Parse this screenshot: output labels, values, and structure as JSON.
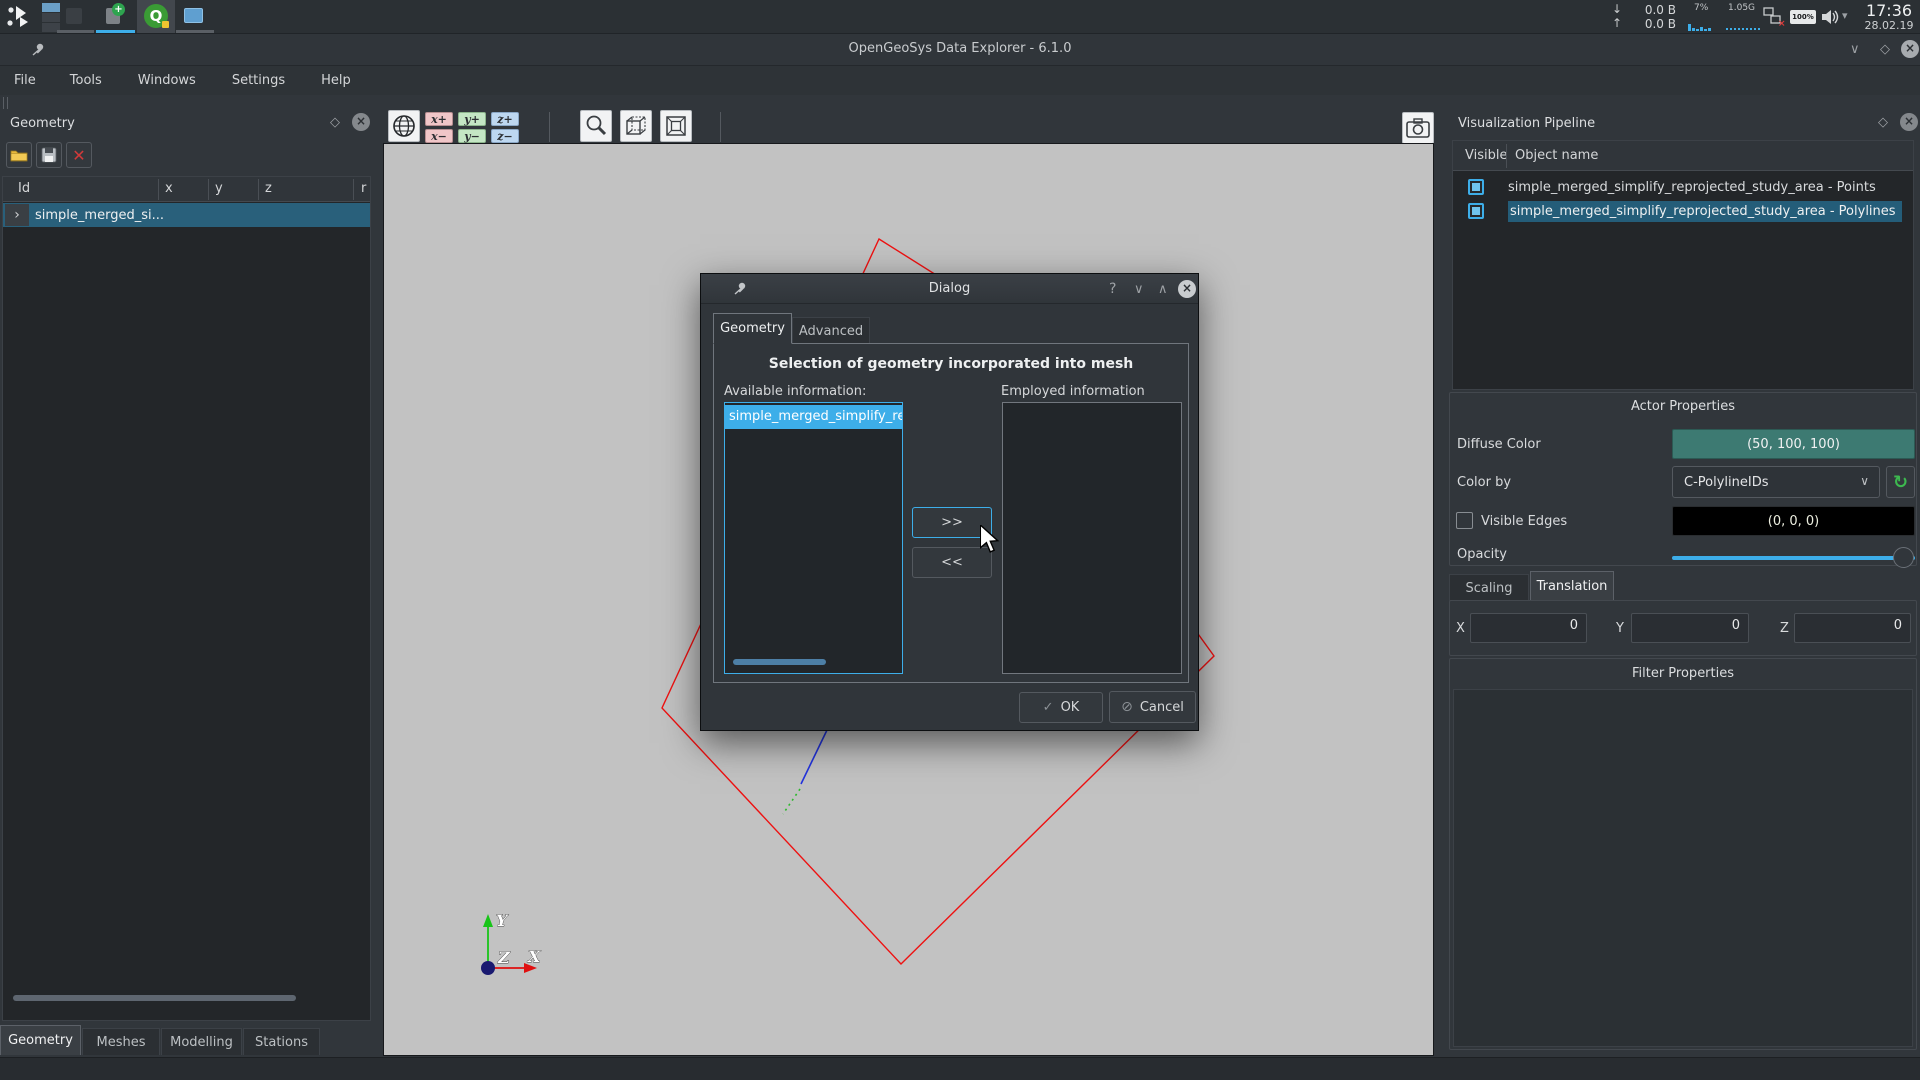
{
  "colors": {
    "accent": "#3daee9",
    "diffuse_button": "#3d7a72",
    "edges_button": "#000000",
    "viewport_bg": "#c2c2c2",
    "selection_row": "#29607b",
    "line_red": "#ee1111",
    "line_blue": "#2233dd",
    "line_green": "#2db92d"
  },
  "taskbar": {
    "tray": {
      "down_label": "0.0 B",
      "up_label": "0.0 B",
      "cpu": "7%",
      "mem": "1.05G",
      "battery": "100%"
    },
    "clock": {
      "time": "17:36",
      "date": "28.02.19"
    }
  },
  "titlebar": {
    "title": "OpenGeoSys Data Explorer - 6.1.0"
  },
  "menubar": {
    "items": [
      "File",
      "Tools",
      "Windows",
      "Settings",
      "Help"
    ]
  },
  "geometry_panel": {
    "title": "Geometry",
    "columns": [
      "Id",
      "x",
      "y",
      "z",
      "r"
    ],
    "tree_item": "simple_merged_si...",
    "expander": "›",
    "tabs": [
      "Geometry",
      "Meshes",
      "Modelling",
      "Stations"
    ],
    "active_tab": "Geometry"
  },
  "view_toolbar": {
    "axis_buttons": [
      "x+",
      "y+",
      "z+",
      "x−",
      "y−",
      "z−"
    ]
  },
  "viewport": {
    "axis_labels": {
      "x": "X",
      "y": "Y",
      "z": "Z"
    }
  },
  "pipeline_panel": {
    "title": "Visualization Pipeline",
    "columns": [
      "Visible",
      "Object name"
    ],
    "rows": [
      {
        "label": "simple_merged_simplify_reprojected_study_area - Points",
        "visible": true,
        "selected": false
      },
      {
        "label": "simple_merged_simplify_reprojected_study_area - Polylines",
        "visible": true,
        "selected": true
      }
    ]
  },
  "actor_properties": {
    "title": "Actor Properties",
    "diffuse_label": "Diffuse Color",
    "diffuse_value": "(50, 100, 100)",
    "colorby_label": "Color by",
    "colorby_value": "C-PolylineIDs",
    "edges_label": "Visible Edges",
    "edges_value": "(0, 0, 0)",
    "opacity_label": "Opacity",
    "transform_tabs": [
      "Scaling",
      "Translation"
    ],
    "active_transform_tab": "Translation",
    "x_label": "X",
    "y_label": "Y",
    "z_label": "Z",
    "x_value": "0",
    "y_value": "0",
    "z_value": "0"
  },
  "filter_properties": {
    "title": "Filter Properties"
  },
  "dialog": {
    "title": "Dialog",
    "help_glyph": "?",
    "tabs": [
      "Geometry",
      "Advanced"
    ],
    "active_tab": "Geometry",
    "heading": "Selection of geometry incorporated into mesh",
    "available_label": "Available information:",
    "employed_label": "Employed information",
    "available_items": [
      "simple_merged_simplify_repr"
    ],
    "add_button": ">>",
    "remove_button": "<<",
    "ok_button": "OK",
    "cancel_button": "Cancel"
  }
}
